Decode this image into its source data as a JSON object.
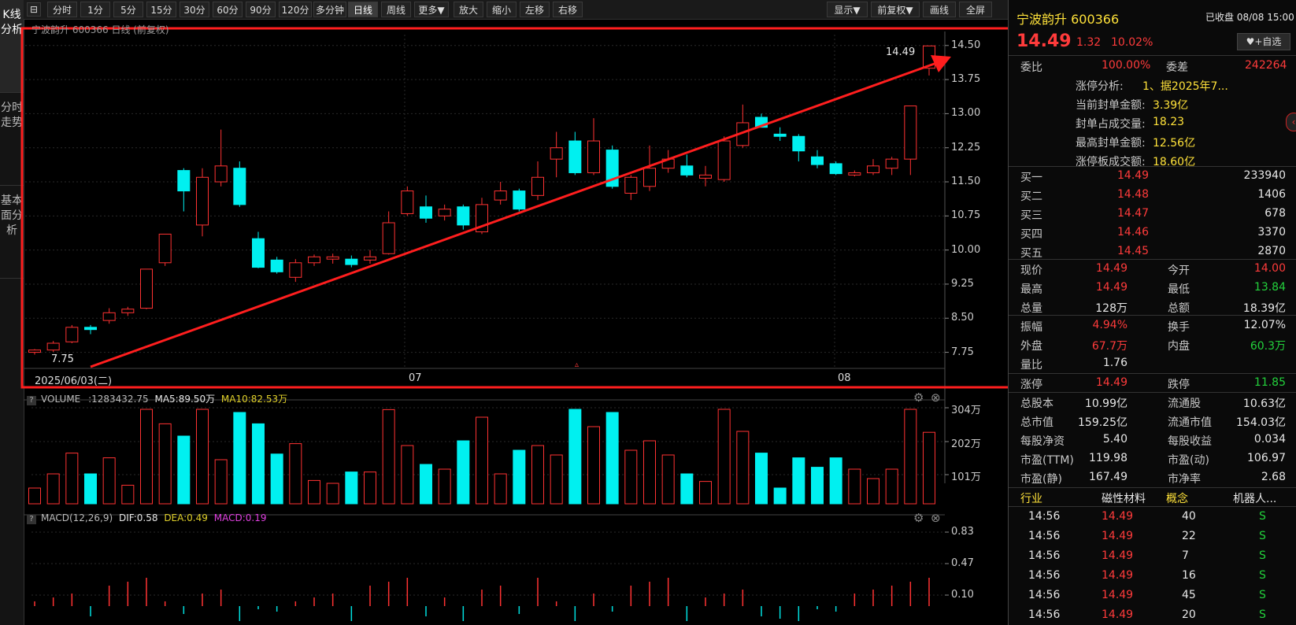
{
  "toolbar": {
    "buttons": [
      "分时",
      "1分",
      "5分",
      "15分",
      "30分",
      "60分",
      "90分",
      "120分",
      "多分钟",
      "日线",
      "周线",
      "更多▼",
      "放大",
      "缩小",
      "左移",
      "右移"
    ],
    "right_buttons": [
      "显示▼",
      "前复权▼",
      "画线",
      "全屏"
    ]
  },
  "left_tabs": [
    "K线分析",
    "分时走势",
    "基本面分析"
  ],
  "kline": {
    "header": "宁波韵升 600366 日线 (前复权)",
    "date_start": "2025/06/03(二)",
    "month_labels": [
      "07",
      "08"
    ],
    "low_label": "7.75",
    "high_label": "14.49",
    "y_ticks": [
      "14.50",
      "13.75",
      "13.00",
      "12.25",
      "11.50",
      "10.75",
      "10.00",
      "9.25",
      "8.50",
      "7.75"
    ]
  },
  "volume": {
    "label": "VOLUME",
    "value": ":1283432.75",
    "ma5": "MA5:89.50万",
    "ma10": "MA10:82.53万",
    "y_ticks": [
      "304万",
      "202万",
      "101万"
    ]
  },
  "macd": {
    "label": "MACD(12,26,9)",
    "dif": "DIF:0.58",
    "dea": "DEA:0.49",
    "macd": "MACD:0.19",
    "y_ticks": [
      "0.83",
      "0.47",
      "0.10"
    ]
  },
  "quote": {
    "name": "宁波韵升 600366",
    "status": "已收盘 08/08 15:00",
    "price": "14.49",
    "change": "1.32",
    "pct": "10.02%",
    "add_fav": "+自选",
    "weibi_label": "委比",
    "weibi": "100.00%",
    "weicha_label": "委差",
    "weicha": "242264",
    "zt": [
      [
        "涨停分析:",
        "1、据2025年7..."
      ],
      [
        "当前封单金额:",
        "3.39亿"
      ],
      [
        "封单占成交量:",
        "18.23"
      ],
      [
        "最高封单金额:",
        "12.56亿"
      ],
      [
        "涨停板成交额:",
        "18.60亿"
      ]
    ],
    "bids": [
      [
        "买一",
        "14.49",
        "233940"
      ],
      [
        "买二",
        "14.48",
        "1406"
      ],
      [
        "买三",
        "14.47",
        "678"
      ],
      [
        "买四",
        "14.46",
        "3370"
      ],
      [
        "买五",
        "14.45",
        "2870"
      ]
    ],
    "stats": [
      [
        "现价",
        "14.49",
        "今开",
        "14.00"
      ],
      [
        "最高",
        "14.49",
        "最低",
        "13.84"
      ],
      [
        "总量",
        "128万",
        "总额",
        "18.39亿"
      ],
      [
        "振幅",
        "4.94%",
        "换手",
        "12.07%"
      ],
      [
        "外盘",
        "67.7万",
        "内盘",
        "60.3万"
      ],
      [
        "量比",
        "1.76",
        "",
        ""
      ],
      [
        "涨停",
        "14.49",
        "跌停",
        "11.85"
      ]
    ],
    "fund": [
      [
        "总股本",
        "10.99亿",
        "流通股",
        "10.63亿"
      ],
      [
        "总市值",
        "159.25亿",
        "流通市值",
        "154.03亿"
      ],
      [
        "每股净资",
        "5.40",
        "每股收益",
        "0.034"
      ],
      [
        "市盈(TTM)",
        "119.98",
        "市盈(动)",
        "106.97"
      ],
      [
        "市盈(静)",
        "167.49",
        "市净率",
        "2.68"
      ]
    ],
    "industry_label": "行业",
    "industry": "磁性材料",
    "concept_label": "概念",
    "concept": "机器人...",
    "ticks": [
      [
        "14:56",
        "14.49",
        "40",
        "S"
      ],
      [
        "14:56",
        "14.49",
        "22",
        "S"
      ],
      [
        "14:56",
        "14.49",
        "7",
        "S"
      ],
      [
        "14:56",
        "14.49",
        "16",
        "S"
      ],
      [
        "14:56",
        "14.49",
        "45",
        "S"
      ],
      [
        "14:56",
        "14.49",
        "20",
        "S"
      ]
    ]
  },
  "chart_data": {
    "type": "candlestick",
    "ylim": [
      7.5,
      14.6
    ],
    "candles": [
      [
        7.75,
        7.8,
        7.7,
        7.82
      ],
      [
        7.8,
        7.95,
        7.76,
        8.0
      ],
      [
        7.98,
        8.3,
        7.95,
        8.35
      ],
      [
        8.3,
        8.25,
        8.15,
        8.35
      ],
      [
        8.45,
        8.62,
        8.38,
        8.72
      ],
      [
        8.62,
        8.7,
        8.55,
        8.75
      ],
      [
        8.72,
        9.58,
        8.7,
        9.58
      ],
      [
        9.72,
        10.35,
        9.65,
        10.35
      ],
      [
        11.75,
        11.3,
        10.85,
        11.8
      ],
      [
        10.55,
        11.6,
        10.3,
        11.8
      ],
      [
        11.5,
        11.85,
        11.4,
        12.65
      ],
      [
        11.8,
        11.0,
        10.95,
        11.95
      ],
      [
        10.25,
        9.62,
        9.6,
        10.4
      ],
      [
        9.78,
        9.52,
        9.48,
        9.85
      ],
      [
        9.4,
        9.72,
        9.3,
        9.8
      ],
      [
        9.72,
        9.85,
        9.65,
        9.9
      ],
      [
        9.8,
        9.85,
        9.7,
        9.92
      ],
      [
        9.8,
        9.68,
        9.62,
        9.88
      ],
      [
        9.78,
        9.85,
        9.7,
        10.0
      ],
      [
        9.92,
        10.6,
        9.9,
        10.85
      ],
      [
        10.8,
        11.3,
        10.75,
        11.4
      ],
      [
        10.95,
        10.7,
        10.6,
        11.2
      ],
      [
        10.75,
        10.9,
        10.65,
        11.0
      ],
      [
        10.95,
        10.55,
        10.45,
        11.0
      ],
      [
        10.4,
        11.0,
        10.35,
        11.15
      ],
      [
        11.1,
        11.3,
        11.0,
        11.5
      ],
      [
        11.3,
        10.9,
        10.85,
        11.35
      ],
      [
        11.2,
        11.6,
        11.1,
        11.95
      ],
      [
        12.0,
        12.25,
        11.6,
        12.6
      ],
      [
        12.4,
        11.7,
        11.65,
        12.6
      ],
      [
        11.7,
        12.4,
        11.65,
        12.9
      ],
      [
        12.2,
        11.4,
        11.35,
        12.3
      ],
      [
        11.25,
        11.6,
        11.1,
        11.65
      ],
      [
        11.4,
        11.8,
        11.3,
        12.3
      ],
      [
        11.8,
        12.0,
        11.7,
        12.2
      ],
      [
        11.85,
        11.65,
        11.6,
        12.1
      ],
      [
        11.58,
        11.65,
        11.4,
        11.85
      ],
      [
        11.55,
        12.4,
        11.5,
        12.5
      ],
      [
        12.3,
        12.8,
        12.25,
        13.2
      ],
      [
        12.92,
        12.7,
        12.7,
        13.0
      ],
      [
        12.55,
        12.5,
        12.4,
        12.7
      ],
      [
        12.5,
        12.18,
        11.95,
        12.55
      ],
      [
        12.05,
        11.88,
        11.8,
        12.2
      ],
      [
        11.9,
        11.68,
        11.65,
        11.95
      ],
      [
        11.65,
        11.7,
        11.62,
        11.75
      ],
      [
        11.7,
        11.85,
        11.65,
        12.0
      ],
      [
        11.8,
        12.0,
        11.65,
        12.05
      ],
      [
        12.0,
        13.17,
        11.65,
        13.17
      ],
      [
        14.0,
        14.49,
        13.84,
        14.49
      ]
    ]
  }
}
